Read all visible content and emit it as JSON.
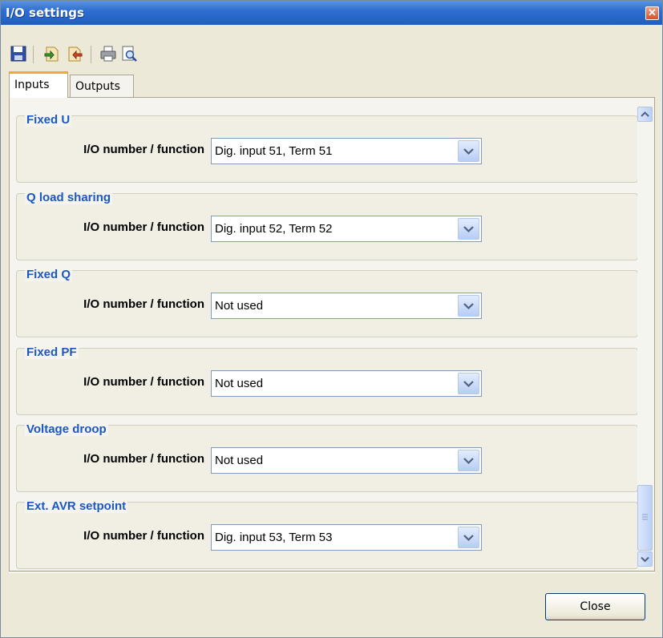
{
  "window": {
    "title": "I/O settings"
  },
  "toolbar": {
    "buttons": [
      "save-icon",
      "import-icon",
      "export-icon",
      "print-icon",
      "print-preview-icon"
    ]
  },
  "tabs": [
    {
      "label": "Inputs",
      "active": true
    },
    {
      "label": "Outputs",
      "active": false
    }
  ],
  "groups": [
    {
      "title": "Fixed U",
      "field_label": "I/O number / function",
      "value": "Dig. input 51, Term  51"
    },
    {
      "title": "Q load sharing",
      "field_label": "I/O number / function",
      "value": "Dig. input 52, Term  52"
    },
    {
      "title": "Fixed Q",
      "field_label": "I/O number / function",
      "value": "Not used"
    },
    {
      "title": "Fixed PF",
      "field_label": "I/O number / function",
      "value": "Not used"
    },
    {
      "title": "Voltage droop",
      "field_label": "I/O number / function",
      "value": "Not used"
    },
    {
      "title": "Ext. AVR setpoint",
      "field_label": "I/O number / function",
      "value": "Dig. input 53, Term  53"
    }
  ],
  "footer": {
    "close_label": "Close"
  },
  "colors": {
    "title_bar": "#2f6fd0",
    "group_title": "#1c58c0",
    "tab_accent": "#f3a63c"
  }
}
